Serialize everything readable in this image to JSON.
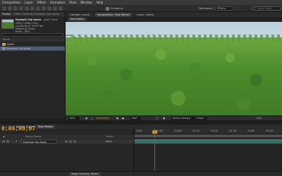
{
  "menu": [
    "Composition",
    "Layer",
    "Effect",
    "Animation",
    "View",
    "Window",
    "Help"
  ],
  "toolbar": {
    "snapping": "Snapping",
    "workspace_label": "Workspace:",
    "workspace_value": "Effects",
    "search_placeholder": "Search Help"
  },
  "project_panel": {
    "tab_label": "Project",
    "tab_extra": "Effect Controls: Example Clip Aaron",
    "clip_name": "Example Clip Aaron",
    "used_count": ", used 1 time",
    "info_lines": [
      "1920 x 1080 (1.00)",
      "Δ 0;00;16;29, 29.97 fps",
      "Millions of Colors",
      "Photo - JPEG"
    ],
    "column_name": "Name",
    "items": [
      {
        "label": "Solids"
      },
      {
        "label": "Example Clip Aaron"
      }
    ]
  },
  "viewer": {
    "tabs": [
      "Footage: (none)",
      "Composition: Slow Motion",
      "Layer: (none)"
    ],
    "active_tab": "Composition: Slow Motion",
    "breadcrumb": "Slow Motion",
    "zoom": "50%",
    "timecode": "0;00;00;07",
    "resolution": "Half",
    "camera": "Active Camera",
    "view_count": "1 View",
    "offset": "+0.0"
  },
  "timeline": {
    "tab_render": "Render Queue",
    "tab_comp": "Slow Motion",
    "timecode": "0;00;00;07",
    "columns": {
      "source_name": "Source Name",
      "parent": "Parent"
    },
    "layer": {
      "number": "1",
      "name": "Example Clip Aaron",
      "parent": "None"
    },
    "toggle_label": "Toggle Switches / Modes",
    "ruler": [
      "0:00f",
      "00:15f",
      "01:00f",
      "01:15f",
      "02:00f",
      "02:15f",
      "03:00f",
      "03:15f"
    ]
  }
}
